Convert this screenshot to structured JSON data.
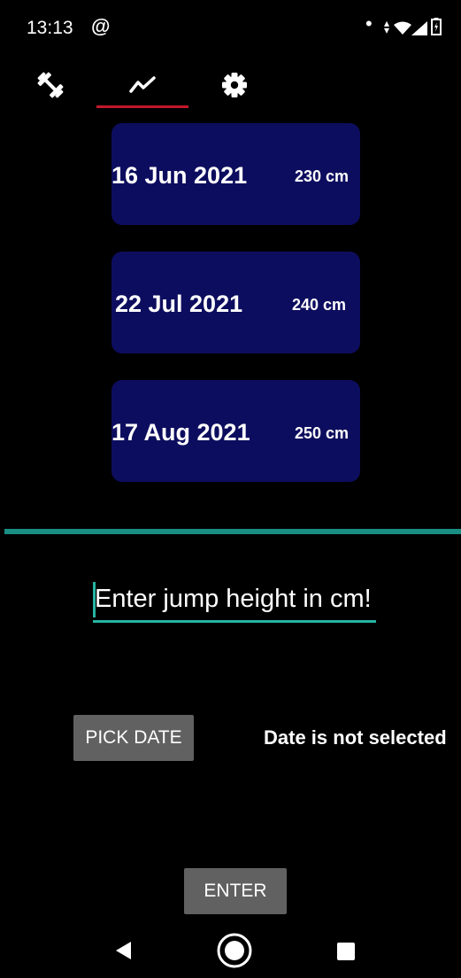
{
  "status_bar": {
    "time": "13:13"
  },
  "tabs": [
    {
      "icon": "dumbbell-icon",
      "selected": false
    },
    {
      "icon": "chart-line-icon",
      "selected": true
    },
    {
      "icon": "gear-icon",
      "selected": false
    }
  ],
  "accent_colors": {
    "card_background": "#0d0d5f",
    "tab_indicator": "#c2182b",
    "divider": "#1a8e83",
    "input_accent": "#26b5a2",
    "button_background": "#616161"
  },
  "entries": [
    {
      "date": "16 Jun 2021",
      "height": "230 cm"
    },
    {
      "date": "22 Jul 2021",
      "height": "240 cm"
    },
    {
      "date": "17 Aug 2021",
      "height": "250 cm"
    }
  ],
  "form": {
    "jump_height_placeholder": "Enter jump height in cm!",
    "pick_date_label": "PICK DATE",
    "date_status": "Date is not selected",
    "enter_label": "ENTER"
  }
}
